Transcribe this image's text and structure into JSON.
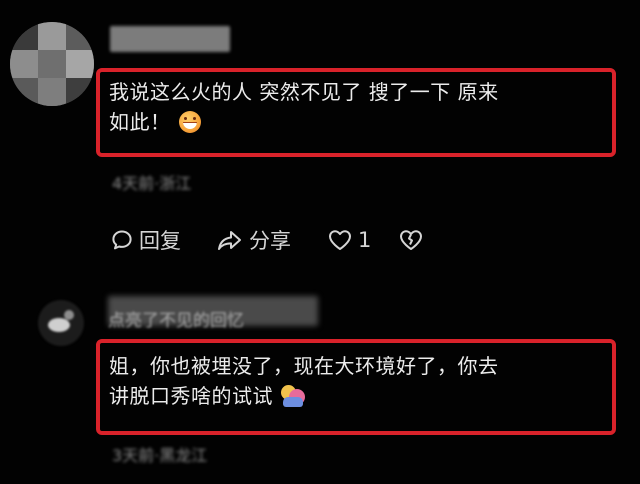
{
  "comments": [
    {
      "text_line1": "我说这么火的人 突然不见了 搜了一下 原来",
      "text_line2": "如此！",
      "emoji": "grinning-face-emoji",
      "meta_blurred": "4天前·浙江",
      "actions": {
        "reply_label": "回复",
        "share_label": "分享",
        "like_count": "1"
      }
    },
    {
      "name_blurred": "点亮了不见的回忆",
      "text_line1": "姐，你也被埋没了，现在大环境好了，你去",
      "text_line2": "讲脱口秀啥的试试",
      "emoji": "people-hugging-emoji",
      "meta_blurred": "3天前·黑龙江"
    }
  ],
  "colors": {
    "background": "#020202",
    "highlight_border": "#d9222a",
    "text": "#ececec",
    "action_text": "#d5d5d5"
  },
  "icons": [
    "reply-bubble-icon",
    "share-arrow-icon",
    "like-heart-icon",
    "dislike-broken-heart-icon"
  ]
}
